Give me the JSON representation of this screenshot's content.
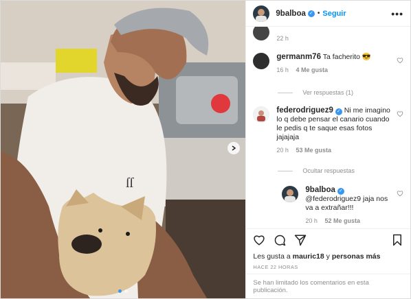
{
  "header": {
    "username": "9balboa",
    "separator": "•",
    "follow_label": "Seguir",
    "more_label": "•••"
  },
  "comments": [
    {
      "kind": "timestamp_only",
      "time": "22 h"
    },
    {
      "username": "germanm76",
      "text": "Ta facherito 😎",
      "time": "16 h",
      "likes": "4 Me gusta"
    },
    {
      "kind": "toggle",
      "label": "Ver respuestas (1)"
    },
    {
      "username": "federodriguez9",
      "verified": true,
      "text": "Ni me imagino lo q debe pensar el canario cuando le pedis q te saque esas fotos jajajaja",
      "time": "20 h",
      "likes": "53 Me gusta"
    },
    {
      "kind": "toggle",
      "label": "Ocultar respuestas"
    },
    {
      "username": "9balboa",
      "verified": true,
      "text": "@federodriguez9 jaja nos va a extrañar!!!",
      "time": "20 h",
      "likes": "52 Me gusta"
    }
  ],
  "likes_line": {
    "prefix": "Les gusta a ",
    "user": "mauric18",
    "middle": " y ",
    "others": "personas más"
  },
  "post_time": "HACE 22 HORAS",
  "comments_disabled": "Se han limitado los comentarios en esta publicación.",
  "colors": {
    "accent": "#0095f6",
    "verified": "#3897f0",
    "muted": "#8e8e8e"
  },
  "icons": [
    "heart-icon",
    "comment-icon",
    "share-icon",
    "bookmark-icon",
    "verified-icon",
    "chevron-right-icon"
  ]
}
